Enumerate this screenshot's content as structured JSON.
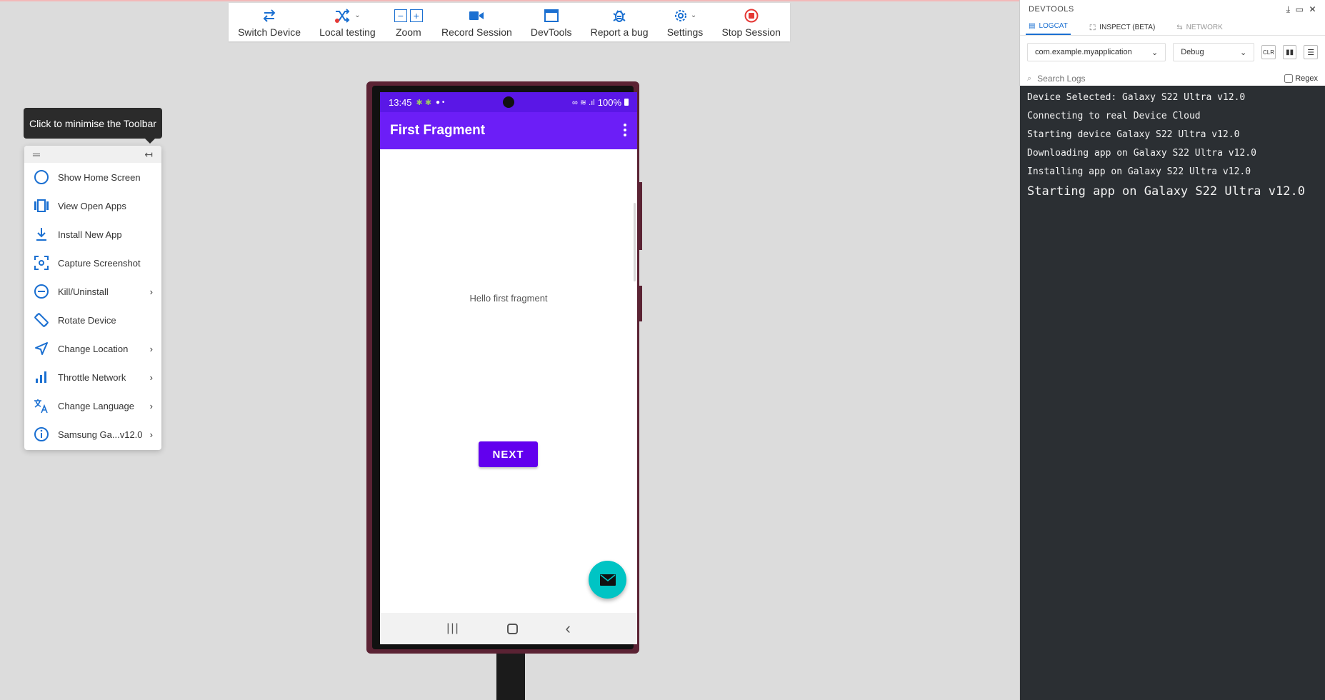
{
  "toolbar": {
    "items": [
      {
        "label": "Switch Device",
        "icon": "switch-arrows-icon"
      },
      {
        "label": "Local testing",
        "icon": "shuffle-icon"
      },
      {
        "label": "Zoom",
        "icon": "zoom-icon"
      },
      {
        "label": "Record Session",
        "icon": "video-camera-icon"
      },
      {
        "label": "DevTools",
        "icon": "window-icon"
      },
      {
        "label": "Report a bug",
        "icon": "bug-icon"
      },
      {
        "label": "Settings",
        "icon": "gear-icon"
      },
      {
        "label": "Stop Session",
        "icon": "stop-icon"
      }
    ],
    "zoom_minus": "−",
    "zoom_plus": "+"
  },
  "tooltip": {
    "text": "Click to minimise the Toolbar"
  },
  "sidemenu": {
    "items": [
      {
        "label": "Show Home Screen",
        "icon": "circle-icon",
        "has_arrow": false
      },
      {
        "label": "View Open Apps",
        "icon": "open-apps-icon",
        "has_arrow": false
      },
      {
        "label": "Install New App",
        "icon": "download-icon",
        "has_arrow": false
      },
      {
        "label": "Capture Screenshot",
        "icon": "screenshot-icon",
        "has_arrow": false
      },
      {
        "label": "Kill/Uninstall",
        "icon": "minus-circle-icon",
        "has_arrow": true
      },
      {
        "label": "Rotate Device",
        "icon": "rotate-device-icon",
        "has_arrow": false
      },
      {
        "label": "Change Location",
        "icon": "location-arrow-icon",
        "has_arrow": true
      },
      {
        "label": "Throttle Network",
        "icon": "signal-bars-icon",
        "has_arrow": true
      },
      {
        "label": "Change Language",
        "icon": "translate-icon",
        "has_arrow": true
      },
      {
        "label": "Samsung Ga...v12.0",
        "icon": "info-icon",
        "has_arrow": true
      }
    ],
    "arrow": "›"
  },
  "phone": {
    "status_time": "13:45",
    "battery": "100%",
    "app_title": "First Fragment",
    "body_text": "Hello first fragment",
    "next_button": "NEXT",
    "colors": {
      "status": "#5a17e6",
      "appbar": "#6c1ef7",
      "button": "#6200ee",
      "fab": "#00c4c4"
    }
  },
  "devtools": {
    "title": "DEVTOOLS",
    "tabs": [
      {
        "label": "LOGCAT",
        "state": "active"
      },
      {
        "label": "INSPECT (BETA)",
        "state": "normal"
      },
      {
        "label": "NETWORK",
        "state": "disabled"
      }
    ],
    "package_select": "com.example.myapplication",
    "level_select": "Debug",
    "clr_label": "CLR",
    "search_placeholder": "Search Logs",
    "regex_label": "Regex",
    "logs": [
      "Device Selected: Galaxy S22 Ultra v12.0",
      "Connecting to real Device Cloud",
      "Starting device Galaxy S22 Ultra v12.0",
      "Downloading app on Galaxy S22 Ultra v12.0",
      "Installing app on Galaxy S22 Ultra v12.0",
      "Starting app on Galaxy S22 Ultra v12.0"
    ]
  }
}
